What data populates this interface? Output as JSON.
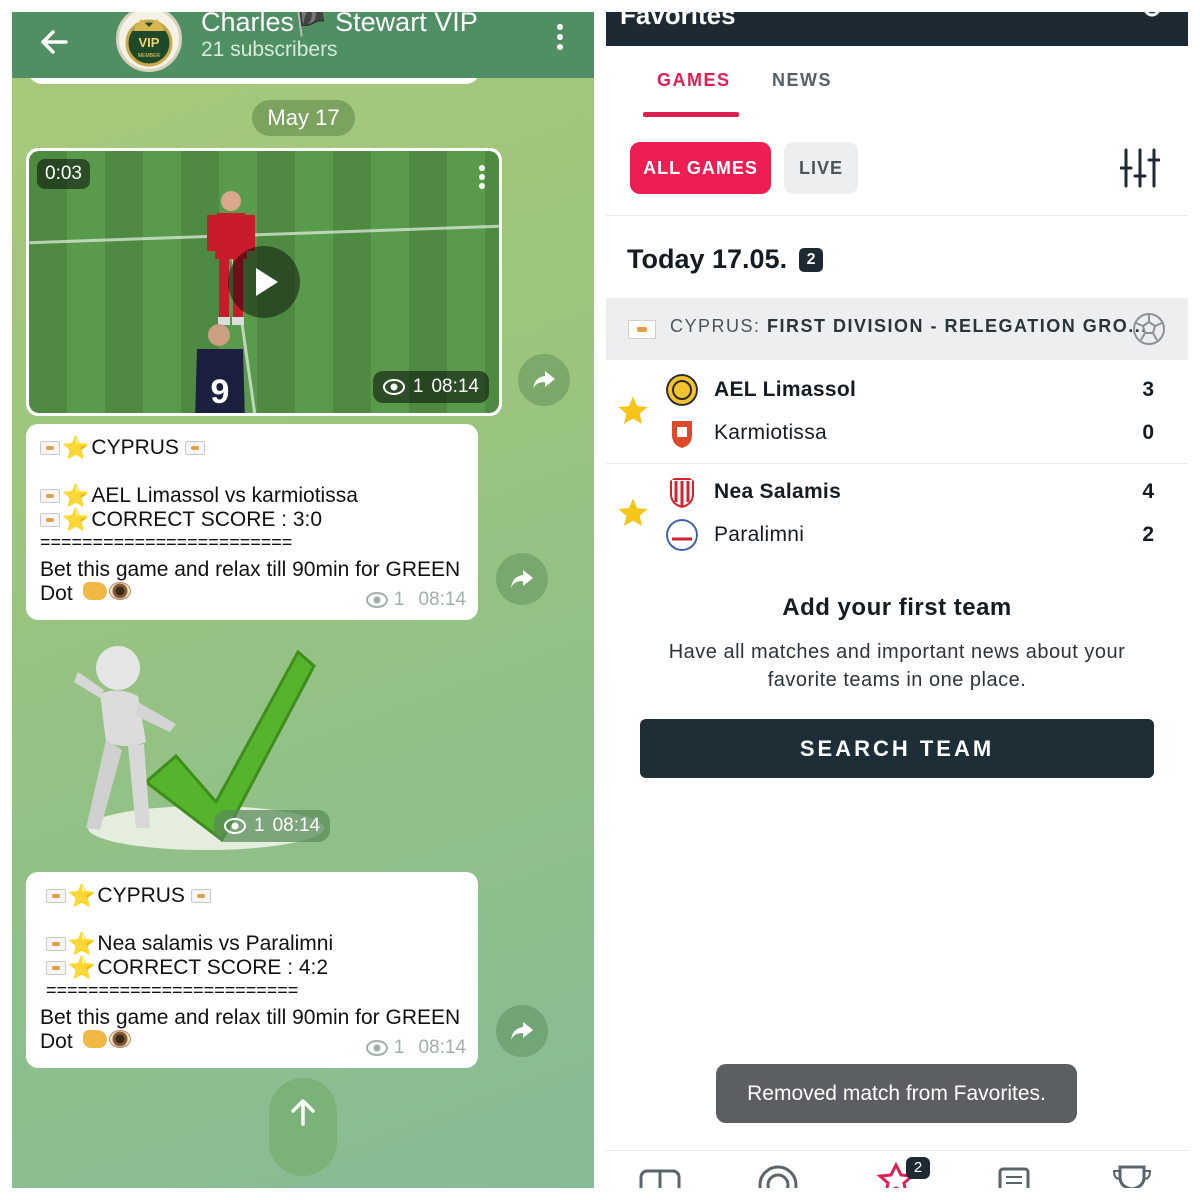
{
  "telegram": {
    "channel_title": "Charles🏴 Stewart VIP",
    "subscribers": "21 subscribers",
    "avatar_text": "VIP",
    "avatar_subtext": "MEMBER",
    "date_pill": "May 17",
    "video": {
      "duration": "0:03",
      "views": "1",
      "time": "08:14",
      "jersey_number": "9"
    },
    "messages": [
      {
        "header": "CYPRUS",
        "match": "AEL Limassol vs karmiotissa",
        "score_line": "CORRECT SCORE :  3:0",
        "separator": "========================",
        "body": "Bet this game and relax till 90min for GREEN Dot",
        "views": "1",
        "time": "08:14"
      },
      {
        "header": "CYPRUS",
        "match": "Nea salamis vs Paralimni",
        "score_line": "CORRECT SCORE :  4:2",
        "separator": "========================",
        "body": "Bet this game and relax till 90min for GREEN Dot",
        "views": "1",
        "time": "08:14"
      }
    ],
    "sticker": {
      "views": "1",
      "time": "08:14"
    }
  },
  "app": {
    "header_partial_title": "Favorites",
    "tabs": [
      {
        "label": "GAMES",
        "active": true
      },
      {
        "label": "NEWS",
        "active": false
      }
    ],
    "filters": [
      {
        "label": "ALL GAMES",
        "active": true
      },
      {
        "label": "LIVE",
        "active": false
      }
    ],
    "day_label": "Today 17.05.",
    "day_count": "2",
    "league": {
      "country": "CYPRUS:",
      "name": "FIRST DIVISION - RELEGATION GRO..."
    },
    "matches": [
      {
        "home": {
          "name": "AEL Limassol",
          "score": "3"
        },
        "away": {
          "name": "Karmiotissa",
          "score": "0"
        }
      },
      {
        "home": {
          "name": "Nea Salamis",
          "score": "4"
        },
        "away": {
          "name": "Paralimni",
          "score": "2"
        }
      }
    ],
    "add_team": {
      "title": "Add your first team",
      "description": "Have all matches and important news about your favorite teams in one place.",
      "button": "SEARCH TEAM"
    },
    "toast": "Removed match from Favorites.",
    "bottom_nav_badge": "2",
    "colors": {
      "accent": "#e21e51",
      "dark": "#1d2a33",
      "star": "#f5c518"
    }
  }
}
